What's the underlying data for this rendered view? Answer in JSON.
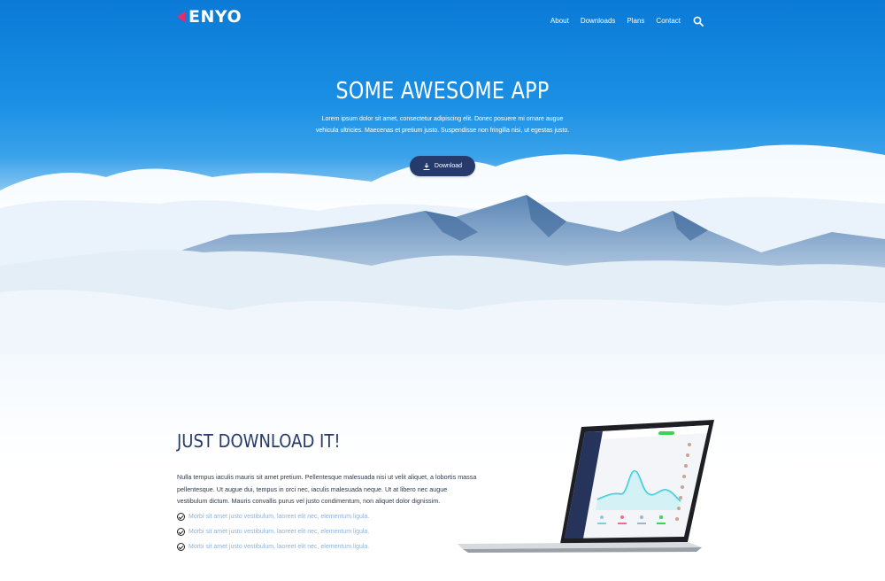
{
  "brand": {
    "name": "ENYO",
    "accent": "#ea2a6a"
  },
  "nav": {
    "items": [
      "About",
      "Downloads",
      "Plans",
      "Contact"
    ],
    "search_icon": "search-icon"
  },
  "hero": {
    "title": "SOME AWESOME APP",
    "subtitle": "Lorem ipsum dolor sit amet, consectetur adipiscing elit. Donec posuere mi ornare augue vehicula ultricies. Maecenas et pretium justo. Suspendisse non fringilla nisi, ut egestas justo.",
    "download_label": "Download"
  },
  "section": {
    "title": "JUST DOWNLOAD IT!",
    "paragraph": "Nulla tempus iaculis mauris sit amet pretium. Pellentesque malesuada nisi ut velit aliquet, a lobortis massa pellentesque. Ut augue dui, tempus in orci nec, iaculis malesuada neque. Ut at libero nec augue vestibulum dictum. Mauris convallis purus vel justo condimentum, non aliquet dolor dignissim.",
    "features": [
      "Morbi sit amet justo vestibulum, laoreet elit nec, elementum ligula.",
      "Morbi sit amet justo vestibulum, laoreet elit nec, elementum ligula.",
      "Morbi sit amet justo vestibulum, laoreet elit nec, elementum ligula."
    ]
  },
  "colors": {
    "primary": "#263a6b",
    "sky": "#1a8fe4",
    "feature_text": "#8fb2d8"
  }
}
